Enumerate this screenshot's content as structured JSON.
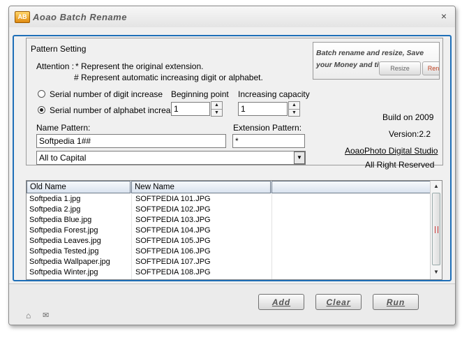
{
  "window": {
    "title": "Aoao Batch Rename",
    "icon_label": "AB",
    "close": "×"
  },
  "pattern": {
    "group_title": "Pattern Setting",
    "attention_label": "Attention :",
    "attention_line1": "* Represent the original extension.",
    "attention_line2": "# Represent automatic increasing digit or alphabet.",
    "radio_digit": "Serial number of digit increase",
    "radio_alpha": "Serial number of alphabet increase",
    "selected_radio": "alpha",
    "beginning_label": "Beginning point",
    "beginning_value": "1",
    "increasing_label": "Increasing capacity",
    "increasing_value": "1",
    "name_pattern_label": "Name Pattern:",
    "name_pattern_value": "Softpedia 1##",
    "ext_pattern_label": "Extension Pattern:",
    "ext_pattern_value": "*",
    "case_selected": "All to Capital"
  },
  "ad": {
    "text": "Batch rename and resize, Save your Money and times !",
    "btn1": "Resize",
    "btn2": "Ren"
  },
  "about": {
    "build": "Build on 2009",
    "version": "Version:2.2",
    "studio": "AoaoPhoto Digital Studio",
    "rights": "All Right Reserved"
  },
  "table": {
    "columns": [
      "Old Name",
      "New Name"
    ],
    "rows": [
      [
        "Softpedia 1.jpg",
        "SOFTPEDIA 101.JPG"
      ],
      [
        "Softpedia 2.jpg",
        "SOFTPEDIA 102.JPG"
      ],
      [
        "Softpedia Blue.jpg",
        "SOFTPEDIA 103.JPG"
      ],
      [
        "Softpedia Forest.jpg",
        "SOFTPEDIA 104.JPG"
      ],
      [
        "Softpedia Leaves.jpg",
        "SOFTPEDIA 105.JPG"
      ],
      [
        "Softpedia Tested.jpg",
        "SOFTPEDIA 106.JPG"
      ],
      [
        "Softpedia Wallpaper.jpg",
        "SOFTPEDIA 107.JPG"
      ],
      [
        "Softpedia Winter.jpg",
        "SOFTPEDIA 108.JPG"
      ]
    ]
  },
  "buttons": {
    "add": "Add",
    "clear": "Clear",
    "run": "Run"
  },
  "icons": {
    "home": "home-icon",
    "mail": "mail-icon",
    "close": "close-icon"
  },
  "colors": {
    "frame_blue": "#1e6fb8"
  }
}
